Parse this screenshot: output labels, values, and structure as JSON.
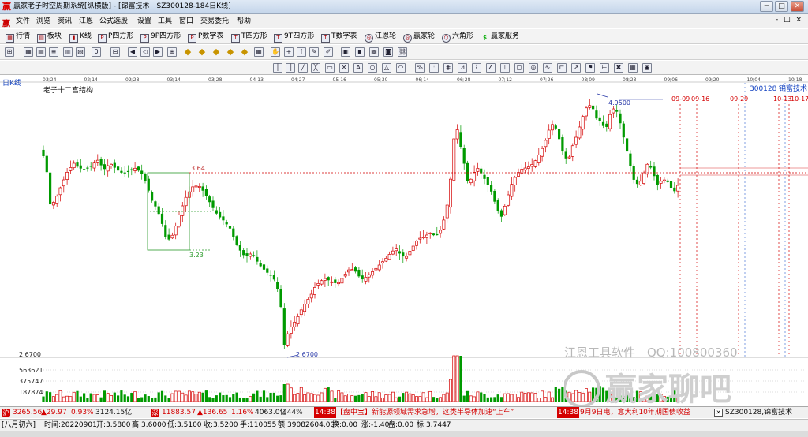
{
  "window": {
    "title": "赢家老子时空周期系统[纵横版] - [锦富技术　SZ300128-184日K线]",
    "min_label": "─",
    "max_label": "□",
    "close_label": "✕"
  },
  "menubar": {
    "items": [
      "文件",
      "浏览",
      "资讯",
      "江恩",
      "公式选股",
      "设置",
      "工具",
      "窗口",
      "交易委托",
      "帮助"
    ],
    "mdi_controls": "- □ ×"
  },
  "toolbar1": {
    "items": [
      "行情",
      "板块",
      "K线",
      "P四方形",
      "9P四方形",
      "P数字表",
      "T四方形",
      "9T四方形",
      "T数字表",
      "江恩轮",
      "赢家轮",
      "六角形",
      "赢家服务"
    ]
  },
  "chart": {
    "period_label": "日K线",
    "indicator_name": "老子十二宫结构",
    "stock_code": "300128",
    "stock_name": "锦富技术",
    "top_dates": [
      "03-24",
      "02-14",
      "02-28",
      "03-14",
      "03-28",
      "04-13",
      "04-27",
      "05-16",
      "05-30",
      "06-14",
      "06-28",
      "07-12",
      "07-26",
      "08-09",
      "08-23",
      "09-06",
      "09-20",
      "10-04",
      "10-18"
    ],
    "cycle_dates": [
      "09-09",
      "09-16",
      "09-29",
      "10-13",
      "10-17"
    ],
    "box_high": "3.64",
    "box_low": "3.23",
    "peak_label": "4.9500",
    "low_label": "2.6700",
    "price_bottom_label": "2.6700",
    "volume_labels": [
      "563621",
      "375747",
      "187874"
    ],
    "colors": {
      "up": "#d40000",
      "down": "#009a00",
      "box": "#2a9a2a",
      "cycle": "#d40000",
      "peak": "#2a3aa8",
      "future_line": "#d33"
    }
  },
  "chart_data": {
    "type": "candlestick",
    "title": "老子十二宫结构",
    "price_range": [
      2.67,
      4.95
    ],
    "box": {
      "high": 3.64,
      "low": 3.23
    },
    "peak": 4.95,
    "low": 2.67,
    "volume_ticks": [
      563621,
      375747,
      187874
    ]
  },
  "statusbar": {
    "sh_icon": "沪",
    "sh_index": "3265.56",
    "sh_change": "▲29.97",
    "sh_pct": "0.93%",
    "sh_amount": "3124.15亿",
    "sz_icon": "深",
    "sz_index": "11883.57",
    "sz_change": "▲136.65",
    "sz_pct": "1.16%",
    "sz_amount": "4063.0亿",
    "zoom": "144%",
    "time1": "14:38",
    "news1": "【盘中宝】新能源领域需求急增，这类半导体加速“上车”",
    "time2": "14:38",
    "news2": "9月9日电，意大利10年期国债收益",
    "right_text": "SZ300128,锦富技术"
  },
  "infobar": {
    "lunar": "[八月初六]",
    "time": "时间:20220901",
    "open": "开:3.5800",
    "high": "高:3.6000",
    "low": "低:3.5100",
    "close": "收:3.5200",
    "hand": "手:110055",
    "amount": "额:39082604.00",
    "change_hand": "换:0.00",
    "rise": "涨:-1.40",
    "zone": "盘:0.00",
    "mark": "标:3.7447"
  },
  "watermark": {
    "company": "江恩工具软件　QQ:100800360",
    "forum": "赢家聊吧",
    "url": "liaoba.vic360.com"
  }
}
